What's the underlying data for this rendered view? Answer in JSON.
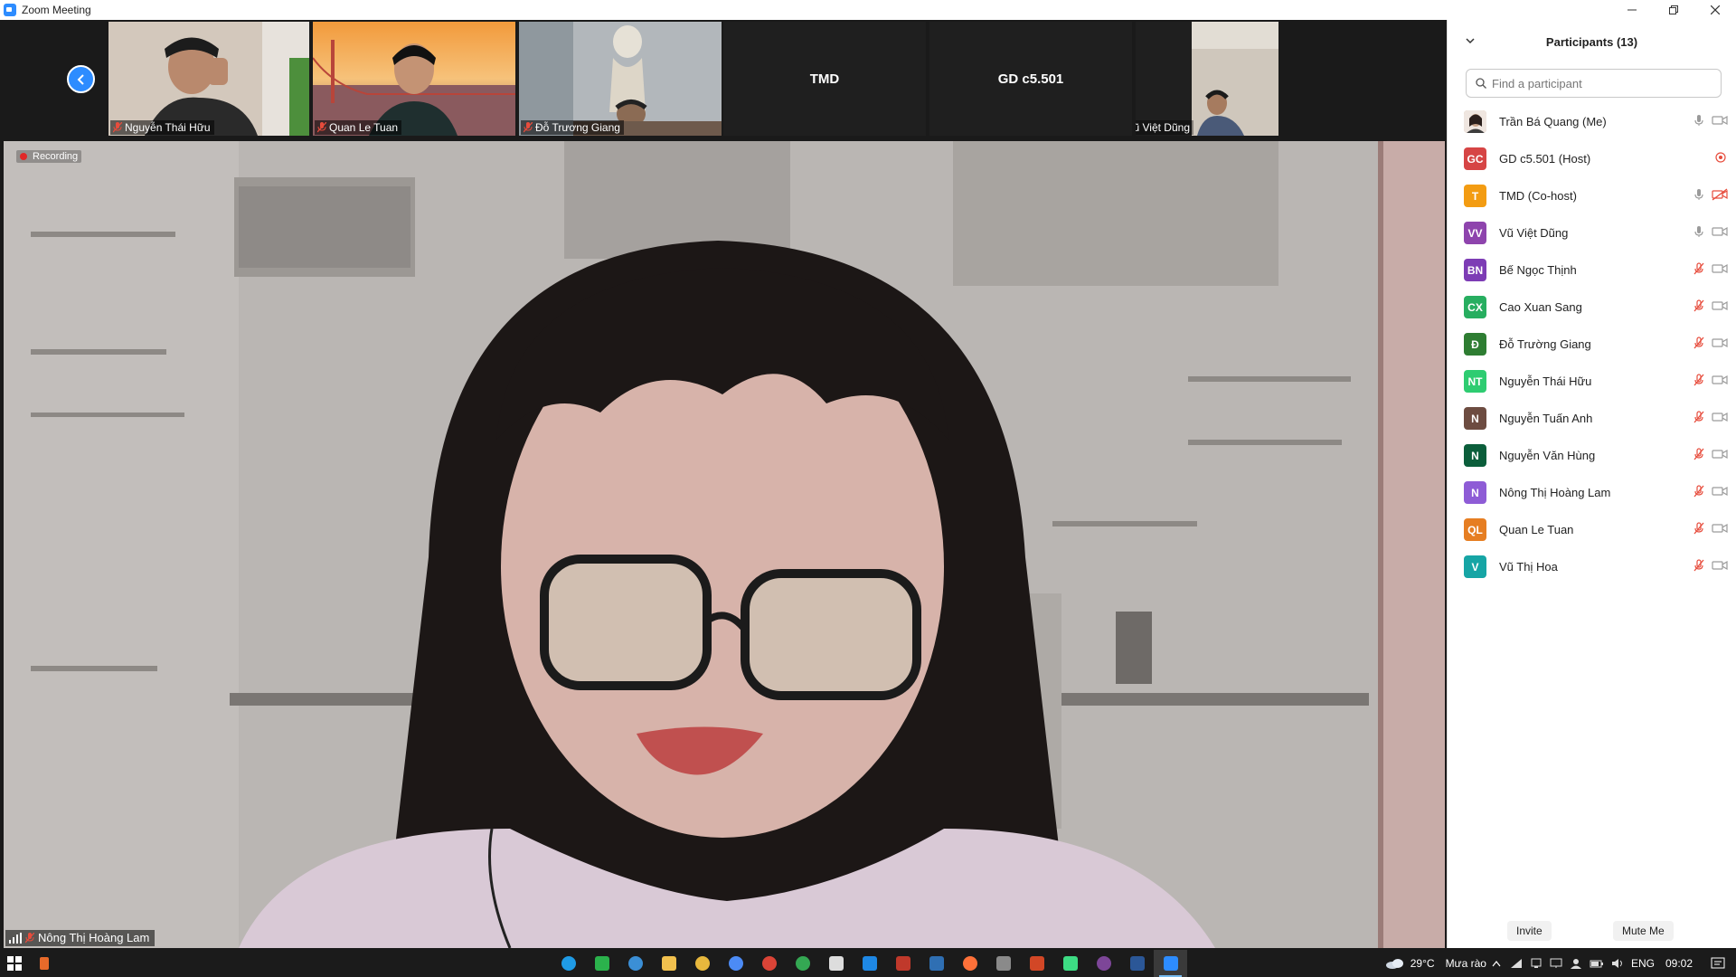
{
  "window": {
    "title": "Zoom Meeting"
  },
  "gallery": {
    "tiles": [
      {
        "name": "Nguyễn Thái Hữu",
        "muted": true,
        "bg": "#cfc3b6"
      },
      {
        "name": "Quan Le Tuan",
        "muted": true,
        "bg": "#e79a4a"
      },
      {
        "name": "Đỗ Trương Giang",
        "muted": true,
        "bg": "#aab1b6"
      },
      {
        "label": "TMD"
      },
      {
        "label": "GD c5.501"
      },
      {
        "name": "Vũ Việt Dũng",
        "muted": false,
        "bg": "#cfc6bb"
      }
    ]
  },
  "main": {
    "recording_label": "Recording",
    "speaker_name": "Nông Thị Hoàng Lam"
  },
  "participants": {
    "title": "Participants (13)",
    "search_placeholder": "Find a participant",
    "items": [
      {
        "name": "Trần Bá Quang (Me)",
        "initials": "",
        "color": "#c9a48a",
        "mic": "on",
        "video": "on"
      },
      {
        "name": "GD c5.501 (Host)",
        "initials": "GC",
        "color": "#d64545",
        "mic": "none",
        "video": "share"
      },
      {
        "name": "TMD (Co-host)",
        "initials": "T",
        "color": "#f39c12",
        "mic": "on",
        "video": "off"
      },
      {
        "name": "Vũ Việt Dũng",
        "initials": "VV",
        "color": "#8e44ad",
        "mic": "on",
        "video": "on"
      },
      {
        "name": "Bế Ngọc Thịnh",
        "initials": "BN",
        "color": "#7d3cb5",
        "mic": "muted",
        "video": "on"
      },
      {
        "name": "Cao Xuan Sang",
        "initials": "CX",
        "color": "#27ae60",
        "mic": "muted",
        "video": "on"
      },
      {
        "name": "Đỗ Trường Giang",
        "initials": "Đ",
        "color": "#2e7d32",
        "mic": "muted",
        "video": "on"
      },
      {
        "name": "Nguyễn Thái Hữu",
        "initials": "NT",
        "color": "#2ecc71",
        "mic": "muted",
        "video": "on"
      },
      {
        "name": "Nguyễn Tuấn Anh",
        "initials": "N",
        "color": "#6d4c41",
        "mic": "muted",
        "video": "on"
      },
      {
        "name": "Nguyễn Văn Hùng",
        "initials": "N",
        "color": "#0b5e3b",
        "mic": "muted",
        "video": "on"
      },
      {
        "name": "Nông Thị Hoàng Lam",
        "initials": "N",
        "color": "#8e5cd6",
        "mic": "muted",
        "video": "on"
      },
      {
        "name": "Quan Le Tuan",
        "initials": "QL",
        "color": "#e67e22",
        "mic": "muted",
        "video": "on"
      },
      {
        "name": "Vũ Thị Hoa",
        "initials": "V",
        "color": "#16a5a5",
        "mic": "muted",
        "video": "on"
      }
    ],
    "footer": {
      "invite": "Invite",
      "mute_me": "Mute Me"
    }
  },
  "taskbar": {
    "apps": [
      {
        "icon": "edge-icon",
        "color": "#1f9be6"
      },
      {
        "icon": "green-app-icon",
        "color": "#2bb24c"
      },
      {
        "icon": "app-store-icon",
        "color": "#3b8fd6"
      },
      {
        "icon": "file-explorer-icon",
        "color": "#f2c14e"
      },
      {
        "icon": "chrome-icon",
        "color": "#e8b83d"
      },
      {
        "icon": "chrome-icon",
        "color": "#4c8bf5"
      },
      {
        "icon": "chrome-icon",
        "color": "#db4437"
      },
      {
        "icon": "chrome-icon",
        "color": "#34a853"
      },
      {
        "icon": "github-icon",
        "color": "#dddddd"
      },
      {
        "icon": "vscode-icon",
        "color": "#1e88e5"
      },
      {
        "icon": "red-app-icon",
        "color": "#c0392b"
      },
      {
        "icon": "powershell-icon",
        "color": "#2f6fb3"
      },
      {
        "icon": "firefox-icon",
        "color": "#ff7139"
      },
      {
        "icon": "settings-app-icon",
        "color": "#8a8a8a"
      },
      {
        "icon": "office-icon",
        "color": "#d24726"
      },
      {
        "icon": "android-studio-icon",
        "color": "#3ddc84"
      },
      {
        "icon": "tor-icon",
        "color": "#7d4698"
      },
      {
        "icon": "word-icon",
        "color": "#2b5797"
      },
      {
        "icon": "zoom-icon",
        "color": "#2d8cff",
        "active": true
      }
    ],
    "weather": "29°C",
    "weather_text": "Mưa rào",
    "lang": "ENG",
    "time": "09:02"
  }
}
